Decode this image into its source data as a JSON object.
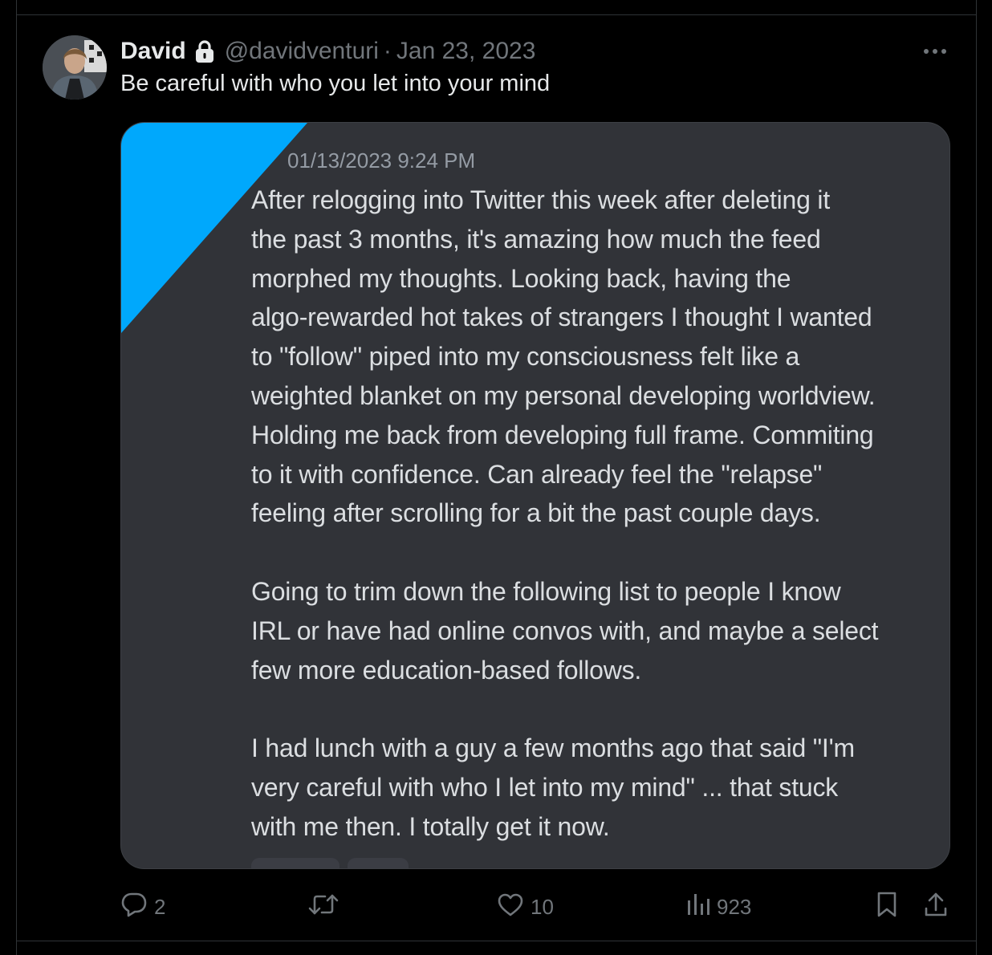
{
  "tweet": {
    "display_name": "David",
    "handle": "@davidventuri",
    "separator": "·",
    "date": "Jan 23, 2023",
    "text": "Be careful with who you let into your mind"
  },
  "screenshot": {
    "timestamp": "01/13/2023 9:24 PM",
    "message": "After relogging into Twitter this week after deleting it\nthe past 3 months, it's amazing how much the feed\nmorphed my thoughts. Looking back, having the\nalgo-rewarded hot takes of strangers I thought I wanted\nto \"follow\" piped into my consciousness felt like a\nweighted blanket on my personal developing worldview.\nHolding me back from developing full frame. Commiting\nto it with confidence. Can already feel the \"relapse\"\nfeeling after scrolling for a bit the past couple days.\n\nGoing to trim down the following list to people I know\nIRL or have had online convos with, and maybe a select\nfew more education-based follows.\n\nI had lunch with a guy a few months ago that said \"I'm\nvery careful with who I let into my mind\" ... that stuck\nwith me then. I totally get it now.",
    "accent_color": "#00a8fc",
    "background_color": "#313338"
  },
  "actions": {
    "replies": "2",
    "reposts": "",
    "likes": "10",
    "views": "923"
  },
  "icons": [
    "lock-icon",
    "more-icon",
    "reply-icon",
    "repost-icon",
    "like-icon",
    "views-icon",
    "bookmark-icon",
    "share-icon"
  ]
}
